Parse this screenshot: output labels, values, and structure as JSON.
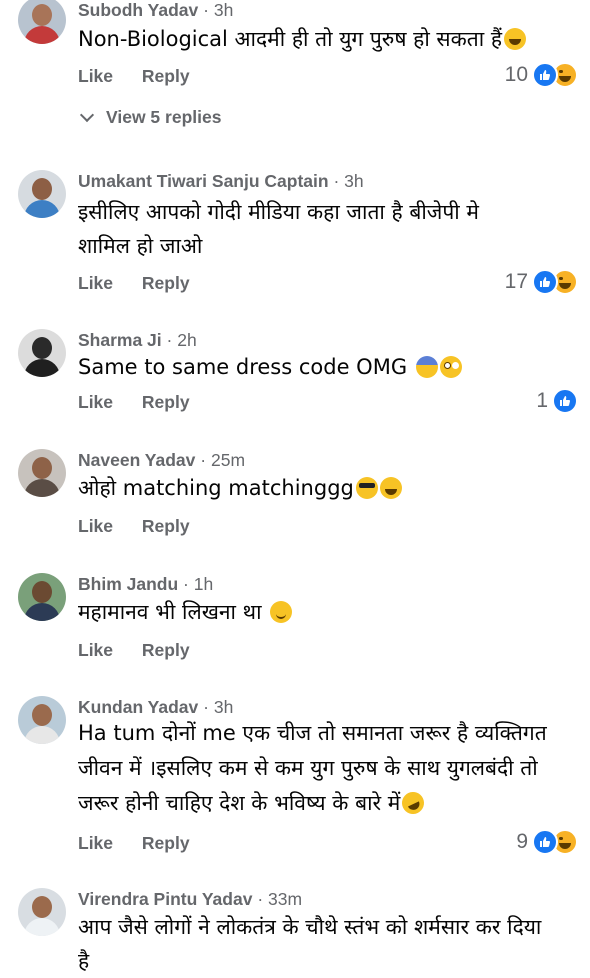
{
  "comments": [
    {
      "name": "Subodh Yadav",
      "time": "3h",
      "text": "Non-Biological आदमी ही तो युग पुरुष हो सकता हैं",
      "emojis": [
        "grin-face"
      ],
      "like": "Like",
      "reply": "Reply",
      "reactions": "10",
      "reaction_icons": [
        "like-icon",
        "haha-icon"
      ],
      "avatar_colors": {
        "bg": "#b8c3cf",
        "head": "#a87458",
        "body": "#c33a3a"
      }
    },
    {
      "name": "Umakant Tiwari Sanju Captain",
      "time": "3h",
      "text": "इसीलिए आपको गोदी मीडिया कहा जाता है  बीजेपी  मे शामिल हो जाओ",
      "like": "Like",
      "reply": "Reply",
      "reactions": "17",
      "reaction_icons": [
        "like-icon",
        "haha-icon"
      ],
      "avatar_colors": {
        "bg": "#d6dbe0",
        "head": "#8d5f45",
        "body": "#3d7fc4"
      }
    },
    {
      "name": "Sharma Ji",
      "time": "2h",
      "text": "Same to same dress code OMG",
      "emojis": [
        "fearful-face",
        "flushed-face"
      ],
      "like": "Like",
      "reply": "Reply",
      "reactions": "1",
      "reaction_icons": [
        "like-icon"
      ],
      "avatar_colors": {
        "bg": "#dcdcdc",
        "head": "#2a2a2a",
        "body": "#1f1f1f"
      }
    },
    {
      "name": "Naveen Yadav",
      "time": "25m",
      "text": "ओहो matching matchinggg",
      "emojis": [
        "sunglasses-face",
        "joy-face"
      ],
      "like": "Like",
      "reply": "Reply",
      "avatar_colors": {
        "bg": "#c7c2bd",
        "head": "#8e6248",
        "body": "#5a4d45"
      }
    },
    {
      "name": "Bhim Jandu",
      "time": "1h",
      "text": "महामानव भी लिखना था",
      "emojis": [
        "smiling-face"
      ],
      "like": "Like",
      "reply": "Reply",
      "avatar_colors": {
        "bg": "#7aa07a",
        "head": "#6b4a32",
        "body": "#2c3b55"
      }
    },
    {
      "name": "Kundan Yadav",
      "time": "3h",
      "text": "Ha tum दोनों me एक चीज तो समानता जरूर है व्यक्तिगत जीवन में ।इसलिए कम से कम युग पुरुष के साथ युगलबंदी तो जरूर होनी चाहिए देश के भविष्य के बारे में",
      "emojis": [
        "rofl-face"
      ],
      "like": "Like",
      "reply": "Reply",
      "reactions": "9",
      "reaction_icons": [
        "like-icon",
        "haha-icon"
      ],
      "avatar_colors": {
        "bg": "#b9cbd8",
        "head": "#9a6a4d",
        "body": "#e7e7e7"
      }
    },
    {
      "name": "Virendra Pintu Yadav",
      "time": "33m",
      "text": "आप जैसे लोगों ने लोकतंत्र के चौथे  स्तंभ को शर्मसार कर दिया है",
      "avatar_colors": {
        "bg": "#d8dde2",
        "head": "#9b6a4c",
        "body": "#eef2f5"
      }
    }
  ],
  "view_replies": "View 5 replies",
  "separator": "·",
  "colors": {
    "accent": "#1877f2",
    "muted": "#65676b"
  }
}
